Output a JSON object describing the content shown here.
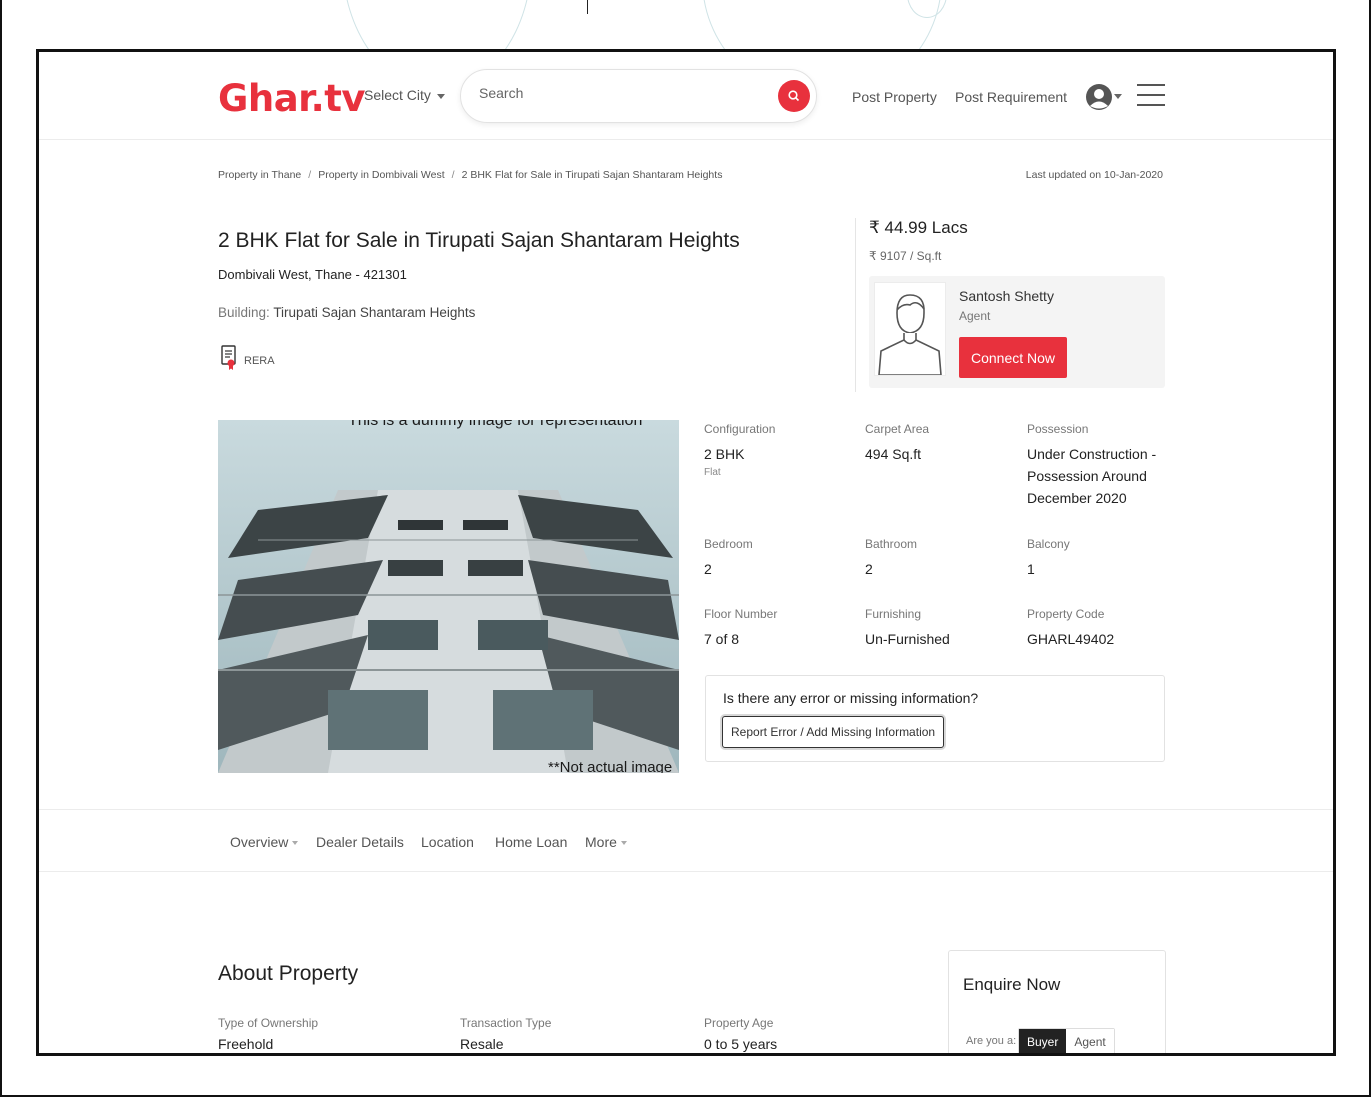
{
  "header": {
    "logo": "Ghar.tv",
    "city_label": "Select City",
    "search_placeholder": "Search",
    "post_property": "Post Property",
    "post_requirement": "Post Requirement"
  },
  "breadcrumb": {
    "items": [
      "Property in Thane",
      "Property in Dombivali West",
      "2 BHK Flat for Sale in Tirupati Sajan Shantaram Heights"
    ],
    "last_updated": "Last updated on 10-Jan-2020"
  },
  "property": {
    "title": "2 BHK Flat for Sale in Tirupati Sajan Shantaram Heights",
    "location": "Dombivali West, Thane - 421301",
    "building_label": "Building:",
    "building_name": "Tirupati Sajan Shantaram Heights",
    "rera": "RERA",
    "price": "₹ 44.99 Lacs",
    "rate": "₹ 9107 / Sq.ft",
    "image_caption_top": "This is a dummy image for representation",
    "image_caption_bottom": "**Not actual image"
  },
  "agent": {
    "name": "Santosh Shetty",
    "role": "Agent",
    "connect_label": "Connect Now"
  },
  "specs": {
    "configuration": {
      "label": "Configuration",
      "value": "2 BHK",
      "sub": "Flat"
    },
    "carpet_area": {
      "label": "Carpet Area",
      "value": "494 Sq.ft"
    },
    "possession": {
      "label": "Possession",
      "value": "Under Construction - Possession Around December 2020"
    },
    "bedroom": {
      "label": "Bedroom",
      "value": "2"
    },
    "bathroom": {
      "label": "Bathroom",
      "value": "2"
    },
    "balcony": {
      "label": "Balcony",
      "value": "1"
    },
    "floor": {
      "label": "Floor Number",
      "value": "7 of 8"
    },
    "furnishing": {
      "label": "Furnishing",
      "value": "Un-Furnished"
    },
    "code": {
      "label": "Property Code",
      "value": "GHARL49402"
    }
  },
  "error_box": {
    "question": "Is there any error or missing information?",
    "button": "Report Error / Add Missing Information"
  },
  "tabs": [
    "Overview",
    "Dealer Details",
    "Location",
    "Home Loan",
    "More"
  ],
  "about": {
    "title": "About Property",
    "ownership": {
      "label": "Type of Ownership",
      "value": "Freehold"
    },
    "transaction": {
      "label": "Transaction Type",
      "value": "Resale"
    },
    "age": {
      "label": "Property Age",
      "value": "0 to 5 years"
    }
  },
  "enquire": {
    "title": "Enquire Now",
    "are_you": "Are you a:",
    "buyer": "Buyer",
    "agent": "Agent"
  },
  "colors": {
    "brand": "#e8313d",
    "text": "#222222",
    "muted": "#777777"
  }
}
